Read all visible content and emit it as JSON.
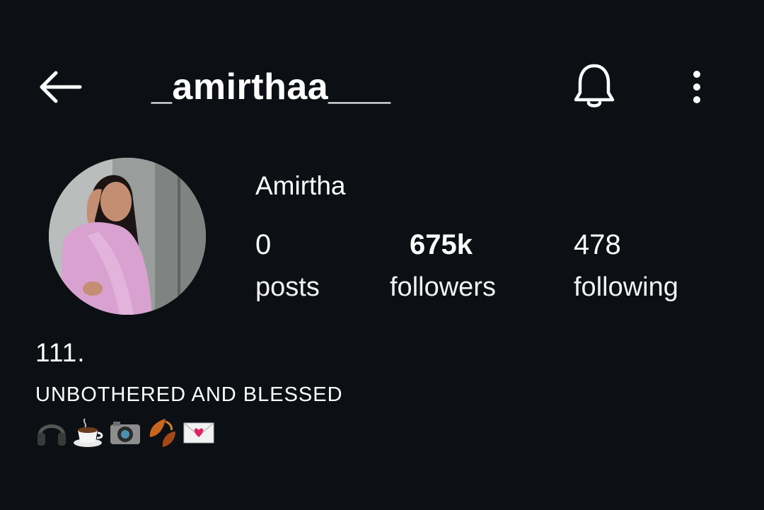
{
  "header": {
    "username": "_amirthaa___",
    "back_icon": "arrow-left-icon",
    "bell_icon": "bell-icon",
    "more_icon": "more-vertical-icon"
  },
  "profile": {
    "display_name": "Amirtha",
    "stats": [
      {
        "value": "0",
        "label": "posts"
      },
      {
        "value": "675k",
        "label": "followers"
      },
      {
        "value": "478",
        "label": "following"
      }
    ],
    "bio": {
      "line1": "111.",
      "line2": "UNBOTHERED AND BLESSED",
      "emojis": [
        "headphones-icon",
        "coffee-icon",
        "camera-icon",
        "fallen-leaves-icon",
        "love-letter-icon"
      ]
    }
  },
  "colors": {
    "background": "#0c0f14",
    "text": "#ffffff"
  }
}
